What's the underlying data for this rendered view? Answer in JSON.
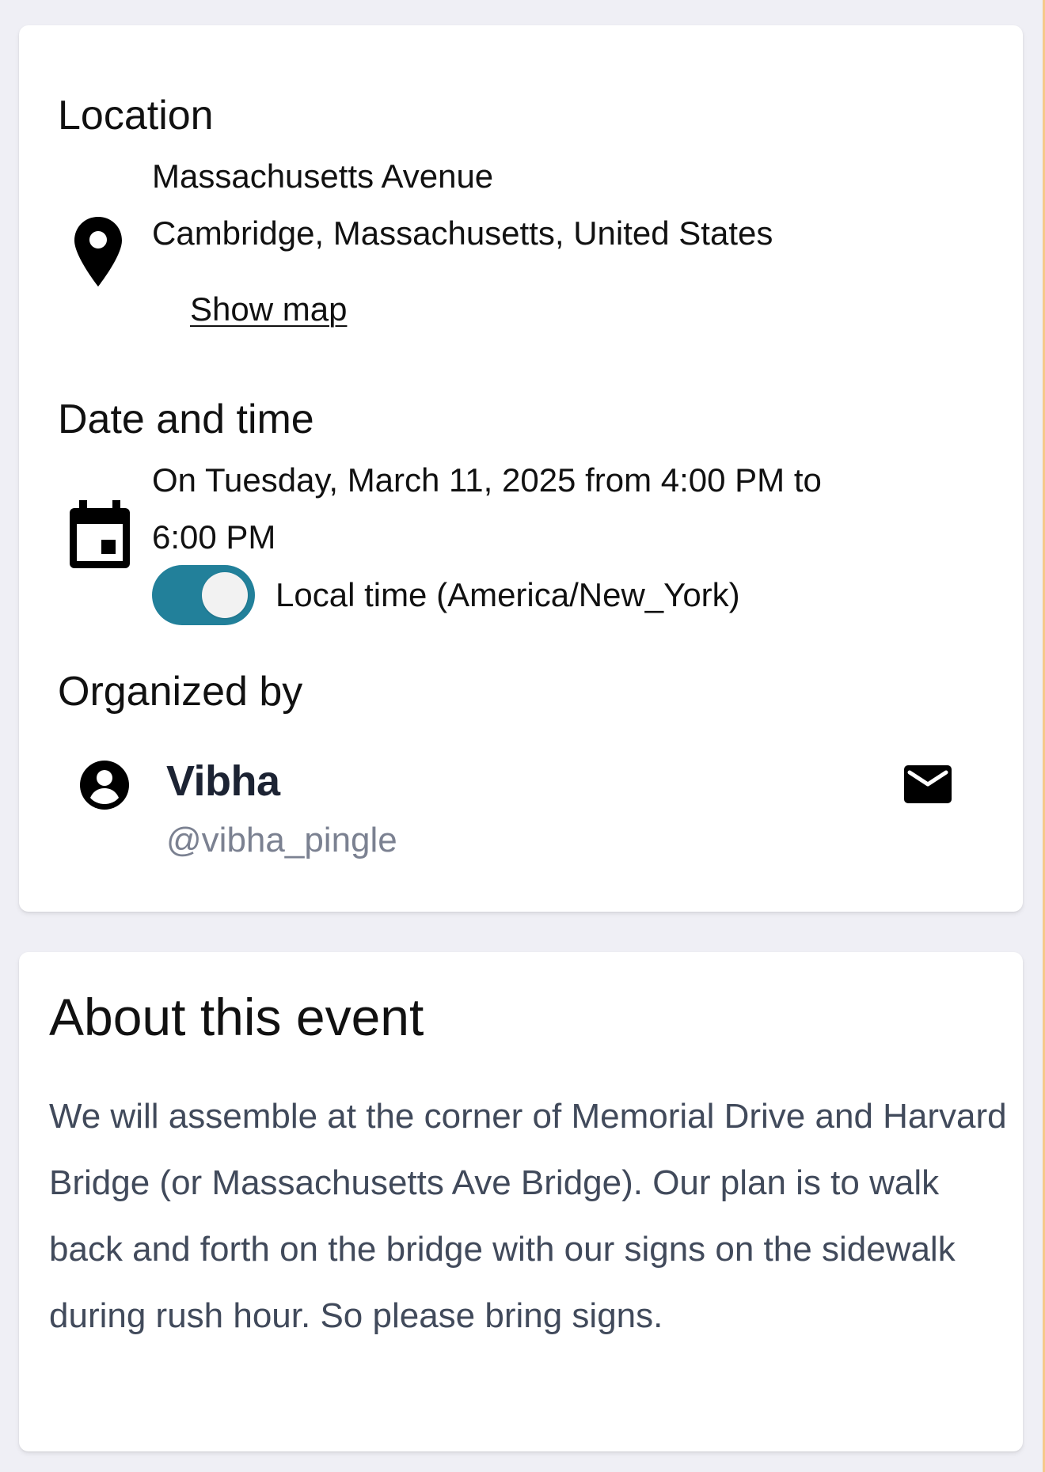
{
  "location": {
    "heading": "Location",
    "icon": "map-pin-icon",
    "address_line1": "Massachusetts Avenue",
    "address_line2": "Cambridge, Massachusetts, United States",
    "show_map_label": "Show map"
  },
  "datetime": {
    "heading": "Date and time",
    "icon": "calendar-icon",
    "line1": "On Tuesday, March 11, 2025 from 4:00 PM to",
    "line2": "6:00 PM",
    "local_time_label": "Local time (America/New_York)",
    "local_time_toggle_on": true,
    "toggle_color": "#22809a"
  },
  "organizer": {
    "heading": "Organized by",
    "avatar_icon": "account-circle-icon",
    "name": "Vibha",
    "handle": "@vibha_pingle",
    "contact_icon": "mail-icon"
  },
  "about": {
    "heading": "About this event",
    "description": "We will assemble at the corner of Memorial Drive and Harvard Bridge (or Massachusetts Ave Bridge). Our plan is to walk back and forth on the bridge with our signs on the sidewalk during rush hour. So please bring signs."
  }
}
